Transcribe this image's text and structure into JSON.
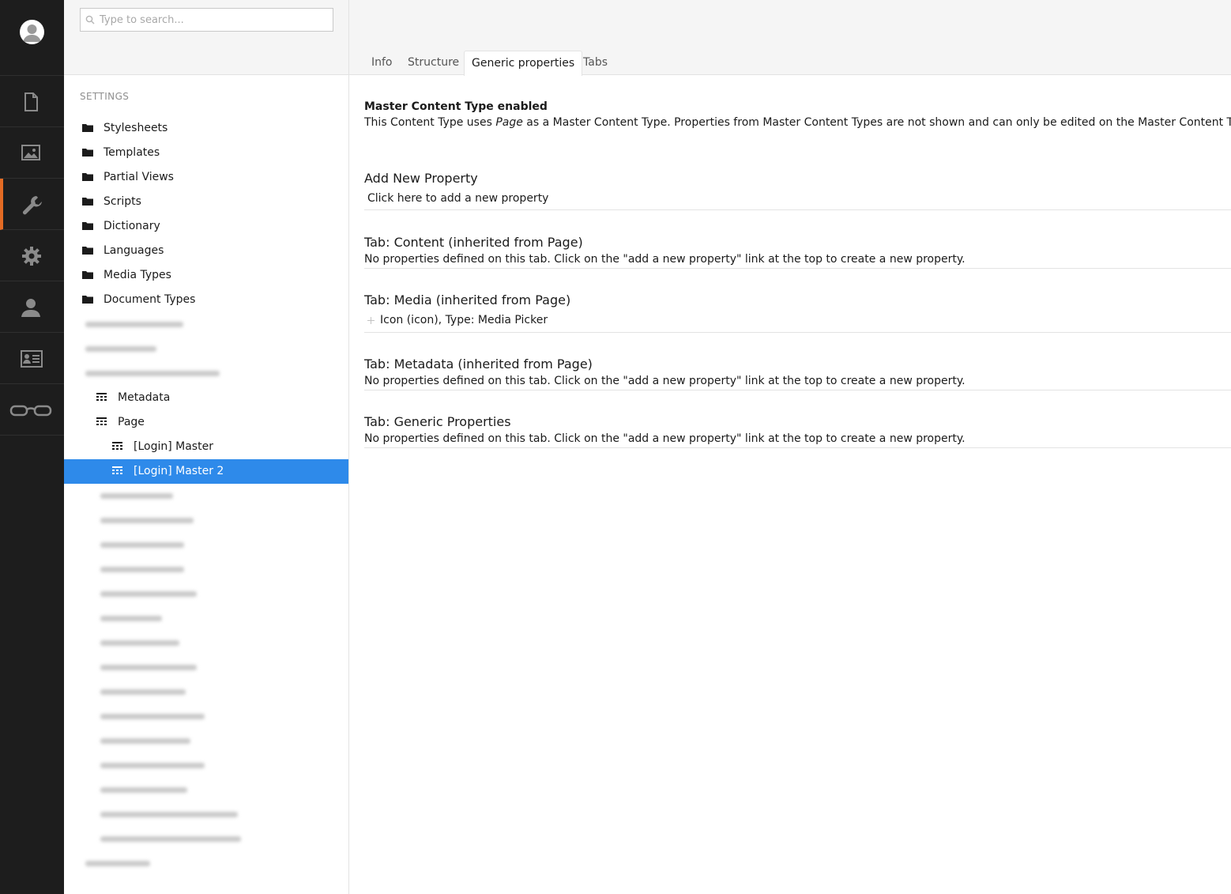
{
  "rail": {
    "icons": [
      "user-avatar-icon",
      "document-icon",
      "image-icon",
      "wrench-icon",
      "gear-icon",
      "person-icon",
      "contact-card-icon",
      "glasses-icon"
    ],
    "accent": "#e36b24"
  },
  "search": {
    "placeholder": "Type to search..."
  },
  "tree": {
    "heading": "SETTINGS",
    "folders": [
      "Stylesheets",
      "Templates",
      "Partial Views",
      "Scripts",
      "Dictionary",
      "Languages",
      "Media Types",
      "Document Types"
    ],
    "doc_types": {
      "metadata": "Metadata",
      "page": "Page",
      "login_master": "[Login] Master",
      "login_master_2": "[Login] Master 2"
    },
    "selected_color": "#2e8aea"
  },
  "tabs": [
    "Info",
    "Structure",
    "Generic properties",
    "Tabs"
  ],
  "active_tab": "Generic properties",
  "editor": {
    "master_title": "Master Content Type enabled",
    "master_text_pre": "This Content Type uses ",
    "master_text_em": "Page",
    "master_text_post": " as a Master Content Type. Properties from Master Content Types are not shown and can only be edited on the Master Content Type itself",
    "add_title": "Add New Property",
    "add_link": "Click here to add a new property",
    "sections": [
      {
        "title": "Tab: Content (inherited from Page)",
        "text": "No properties defined on this tab. Click on the \"add a new property\" link at the top to create a new property."
      },
      {
        "title": "Tab: Media (inherited from Page)",
        "text": "Icon (icon), Type: Media Picker"
      },
      {
        "title": "Tab: Metadata (inherited from Page)",
        "text": "No properties defined on this tab. Click on the \"add a new property\" link at the top to create a new property."
      },
      {
        "title": "Tab: Generic Properties",
        "text": "No properties defined on this tab. Click on the \"add a new property\" link at the top to create a new property."
      }
    ]
  }
}
